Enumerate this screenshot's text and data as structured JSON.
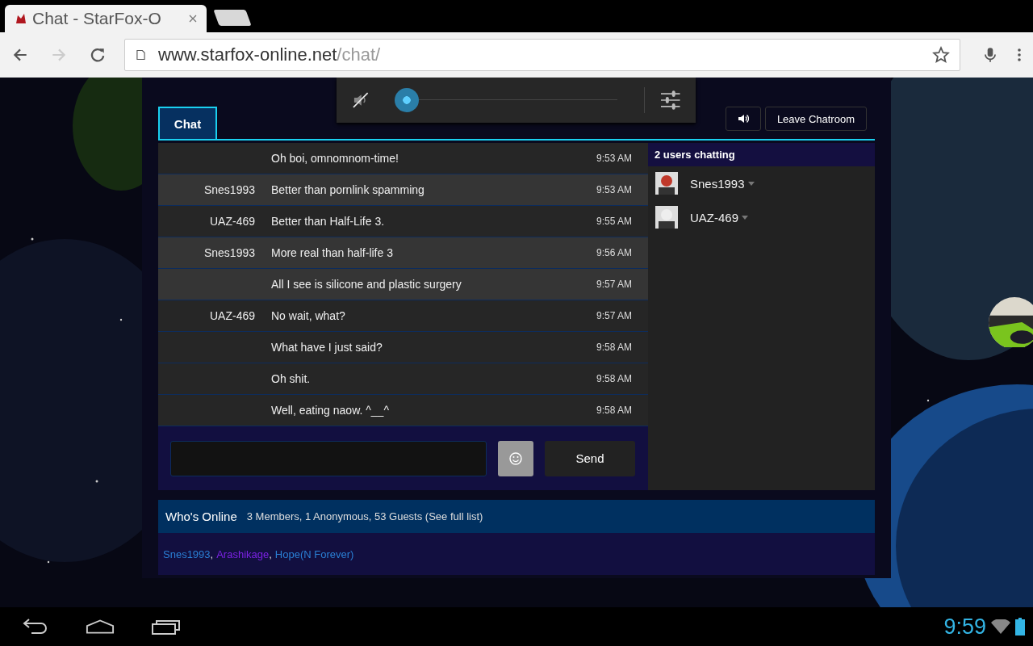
{
  "browser": {
    "tab_title": "Chat - StarFox-O",
    "url_host": "www.starfox-online.net",
    "url_path": "/chat/",
    "forward_disabled": true
  },
  "volume_popup": {
    "muted": true,
    "level": 0.0
  },
  "chat": {
    "tabs": [
      {
        "label": "Chat",
        "selected": true
      }
    ],
    "leave_button": "Leave Chatroom",
    "messages": [
      {
        "text": "Oh boi, omnomnom-time!",
        "time": "9:53 AM",
        "highlighted": false
      },
      {
        "user": "Snes1993",
        "text": "Better than pornlink spamming",
        "time": "9:53 AM",
        "highlighted": true
      },
      {
        "user": "UAZ-469",
        "text": "Better than Half-Life 3.",
        "time": "9:55 AM",
        "highlighted": false
      },
      {
        "user": "Snes1993",
        "text": "More real than half-life 3",
        "time": "9:56 AM",
        "highlighted": true
      },
      {
        "text": "All I see is silicone and plastic surgery",
        "time": "9:57 AM",
        "highlighted": true
      },
      {
        "user": "UAZ-469",
        "text": "No wait, what?",
        "time": "9:57 AM",
        "highlighted": false
      },
      {
        "text": "What have I just said?",
        "time": "9:58 AM",
        "highlighted": false
      },
      {
        "text": "Oh shit.",
        "time": "9:58 AM",
        "highlighted": false
      },
      {
        "text": "Well, eating naow. ^__^",
        "time": "9:58 AM",
        "highlighted": false
      }
    ],
    "users_header": "2 users chatting",
    "users": [
      {
        "name": "Snes1993",
        "color": "#c0392b"
      },
      {
        "name": "UAZ-469",
        "color": "#eeeeee"
      }
    ],
    "send_button": "Send"
  },
  "whos_online": {
    "title": "Who's Online",
    "summary": "3 Members, 1 Anonymous, 53 Guests (See full list)",
    "separator": ",",
    "members": [
      {
        "name": "Snes1993",
        "color": "#2a7fd4"
      },
      {
        "name": "Arashikage",
        "color": "#7a22e0"
      },
      {
        "name": "Hope(N Forever)",
        "color": "#2a7fd4"
      }
    ]
  },
  "status_bar": {
    "time": "9:59"
  }
}
